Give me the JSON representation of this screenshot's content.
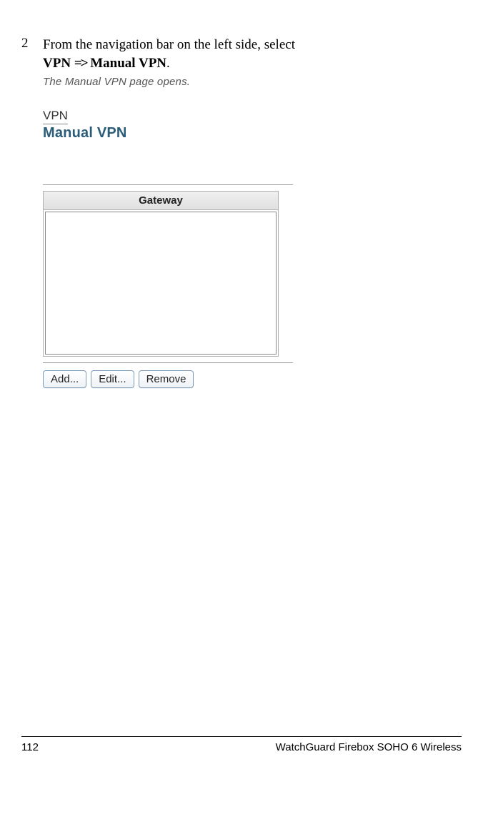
{
  "step": {
    "number": "2",
    "text_prefix": "From the navigation bar on the left side, select",
    "path_part1": "VPN",
    "arrow": "=>",
    "path_part2": "Manual VPN",
    "period": ".",
    "note": "The Manual VPN page opens."
  },
  "screenshot": {
    "breadcrumb_top": "VPN",
    "breadcrumb_bottom": "Manual VPN",
    "table_header": "Gateway",
    "buttons": {
      "add": "Add...",
      "edit": "Edit...",
      "remove": "Remove"
    }
  },
  "footer": {
    "page_number": "112",
    "title": "WatchGuard Firebox SOHO 6 Wireless"
  }
}
